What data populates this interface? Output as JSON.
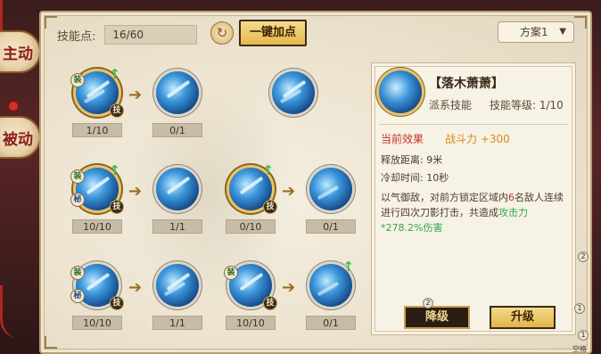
{
  "side_tabs": {
    "active_label": "主动",
    "passive_label": "被动"
  },
  "top": {
    "skill_points_label": "技能点:",
    "skill_points_value": "16/60",
    "one_key_add_label": "一键加点",
    "plan_selected": "方案1"
  },
  "tree": {
    "rows": [
      [
        {
          "level": "1/10",
          "badges": [
            "装",
            "技"
          ],
          "upgradable": true
        },
        {
          "level": "0/1",
          "badges": []
        },
        {
          "level": "",
          "badges": []
        }
      ],
      [
        {
          "level": "10/10",
          "badges": [
            "装",
            "秘",
            "技"
          ],
          "upgradable": true
        },
        {
          "level": "1/1",
          "badges": []
        },
        {
          "level": "0/10",
          "badges": [
            "技"
          ],
          "upgradable": true
        },
        {
          "level": "0/1",
          "badges": []
        }
      ],
      [
        {
          "level": "10/10",
          "badges": [
            "装",
            "秘",
            "技"
          ]
        },
        {
          "level": "1/1",
          "badges": []
        },
        {
          "level": "10/10",
          "badges": [
            "装",
            "技"
          ]
        },
        {
          "level": "0/1",
          "badges": [],
          "upgradable": true
        }
      ]
    ]
  },
  "detail": {
    "name": "【落木萧萧】",
    "type": "派系技能",
    "level_label": "技能等级: 1/10",
    "effect_title": "当前效果",
    "effect_value": "战斗力 +300",
    "range": "释放距离: 9米",
    "cooldown": "冷却时间: 10秒",
    "desc_part1": "以气御敌，对前方锁定区域内",
    "desc_count": "6",
    "desc_part2": "名敌人连续进行四次刀影打击，共造成",
    "desc_damage": "攻击力*278.2%伤害",
    "downgrade_label": "降级",
    "upgrade_label": "升级"
  },
  "misc": {
    "dot_1": "2",
    "dot_2": "2",
    "dot_3": "1",
    "dot_4": "1",
    "corner_text": "空格"
  }
}
